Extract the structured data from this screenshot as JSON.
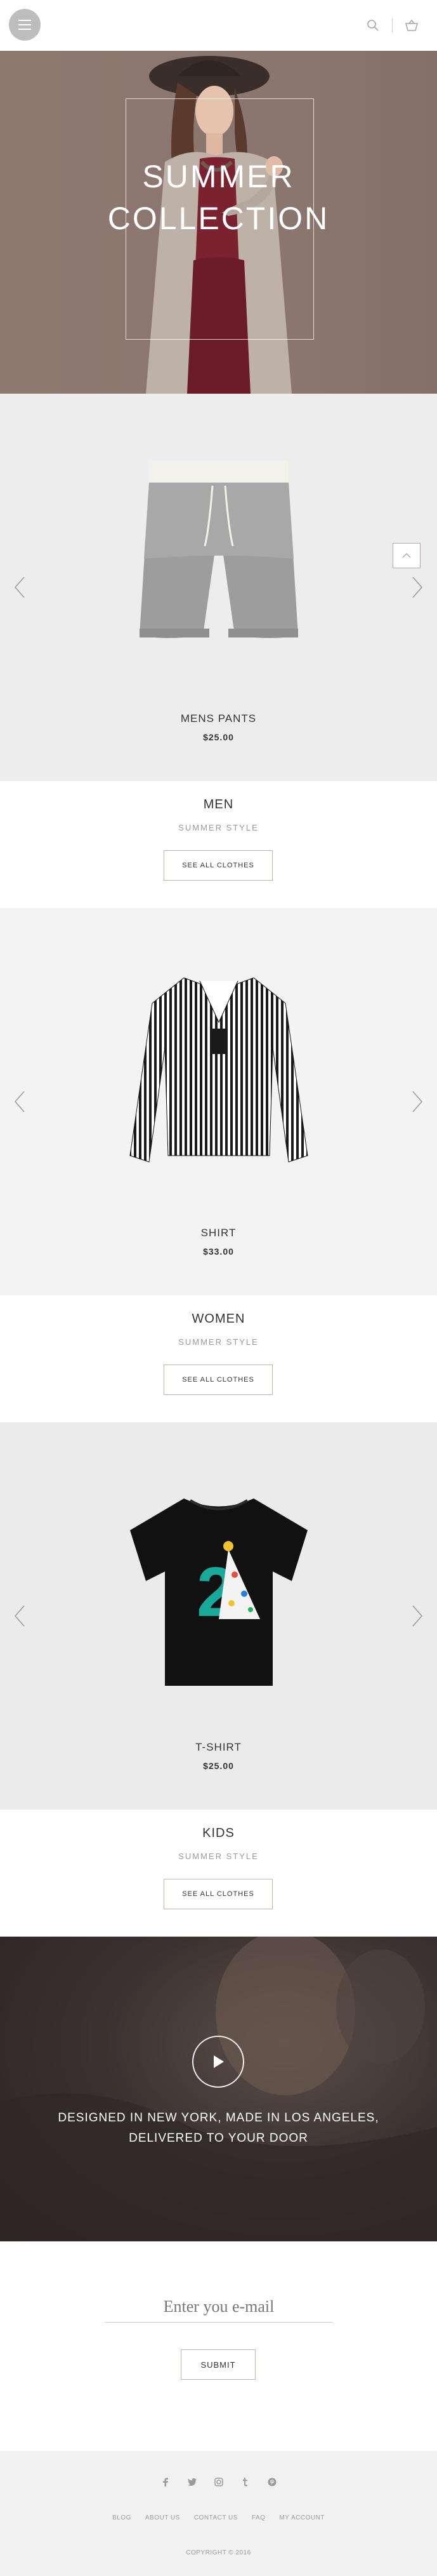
{
  "header": {
    "menu_icon": "hamburger-icon",
    "search_icon": "search-icon",
    "cart_icon": "basket-icon"
  },
  "hero": {
    "title_line1": "SUMMER",
    "title_line2": "COLLECTION"
  },
  "products": [
    {
      "name": "MENS PANTS",
      "price": "$25.00"
    },
    {
      "name": "SHIRT",
      "price": "$33.00"
    },
    {
      "name": "T-SHIRT",
      "price": "$25.00"
    }
  ],
  "categories": [
    {
      "title": "MEN",
      "subtitle": "SUMMER STYLE",
      "button": "SEE ALL CLOTHES"
    },
    {
      "title": "WOMEN",
      "subtitle": "SUMMER STYLE",
      "button": "SEE ALL CLOTHES"
    },
    {
      "title": "KIDS",
      "subtitle": "SUMMER STYLE",
      "button": "SEE ALL CLOTHES"
    }
  ],
  "video": {
    "text": "DESIGNED IN NEW YORK, MADE IN LOS ANGELES, DELIVERED TO YOUR DOOR"
  },
  "subscribe": {
    "placeholder": "Enter you e-mail",
    "submit_label": "SUBMIT"
  },
  "footer": {
    "social": [
      "f",
      "t",
      "ig",
      "tu",
      "p"
    ],
    "links": [
      "BLOG",
      "ABOUT US",
      "CONTACT US",
      "FAQ",
      "MY ACCOUNT"
    ],
    "copyright": "COPYRIGHT © 2016"
  },
  "colors": {
    "accent_border": "#c9b3a7",
    "hero_bg": "#8a766e",
    "gray_bg": "#ededed"
  }
}
